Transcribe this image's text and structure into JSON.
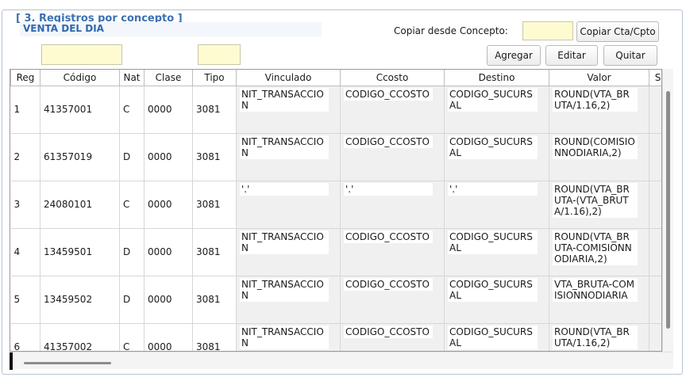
{
  "section": {
    "title": "[ 3. Registros por concepto ]",
    "concept_name": "VENTA DEL DIA"
  },
  "copy": {
    "label": "Copiar desde Concepto:",
    "input_value": "",
    "button_label": "Copiar Cta/Cpto"
  },
  "filters": {
    "field_1_value": "",
    "field_2_value": ""
  },
  "toolbar": {
    "add_label": "Agregar",
    "edit_label": "Editar",
    "remove_label": "Quitar"
  },
  "table": {
    "columns": [
      "Reg",
      "Código",
      "Nat",
      "Clase",
      "Tipo",
      "Vinculado",
      "Ccosto",
      "Destino",
      "Valor",
      "S"
    ],
    "rows": [
      {
        "reg": "1",
        "codigo": "41357001",
        "nat": "C",
        "clase": "0000",
        "tipo": "3081",
        "vinculado": "NIT_TRANSACCION",
        "ccosto": "CODIGO_CCOSTO",
        "destino": "CODIGO_SUCURSAL",
        "valor": "ROUND(VTA_BRUTA/1.16,2)"
      },
      {
        "reg": "2",
        "codigo": "61357019",
        "nat": "D",
        "clase": "0000",
        "tipo": "3081",
        "vinculado": "NIT_TRANSACCION",
        "ccosto": "CODIGO_CCOSTO",
        "destino": "CODIGO_SUCURSAL",
        "valor": "ROUND(COMISIONNODIARIA,2)"
      },
      {
        "reg": "3",
        "codigo": "24080101",
        "nat": "C",
        "clase": "0000",
        "tipo": "3081",
        "vinculado": "'.'",
        "ccosto": "'.'",
        "destino": "'.'",
        "valor": "ROUND(VTA_BRUTA-(VTA_BRUTA/1.16),2)"
      },
      {
        "reg": "4",
        "codigo": "13459501",
        "nat": "D",
        "clase": "0000",
        "tipo": "3081",
        "vinculado": "NIT_TRANSACCION",
        "ccosto": "CODIGO_CCOSTO",
        "destino": "CODIGO_SUCURSAL",
        "valor": "ROUND(VTA_BRUTA-COMISIONNODIARIA,2)"
      },
      {
        "reg": "5",
        "codigo": "13459502",
        "nat": "D",
        "clase": "0000",
        "tipo": "3081",
        "vinculado": "NIT_TRANSACCION",
        "ccosto": "CODIGO_CCOSTO",
        "destino": "CODIGO_SUCURSAL",
        "valor": "VTA_BRUTA-COMISIONNODIARIA"
      },
      {
        "reg": "6",
        "codigo": "41357002",
        "nat": "C",
        "clase": "0000",
        "tipo": "3081",
        "vinculado": "NIT_TRANSACCION",
        "ccosto": "CODIGO_CCOSTO",
        "destino": "CODIGO_SUCURSAL",
        "valor": "ROUND(VTA_BRUTA/1.16,2)"
      }
    ]
  }
}
